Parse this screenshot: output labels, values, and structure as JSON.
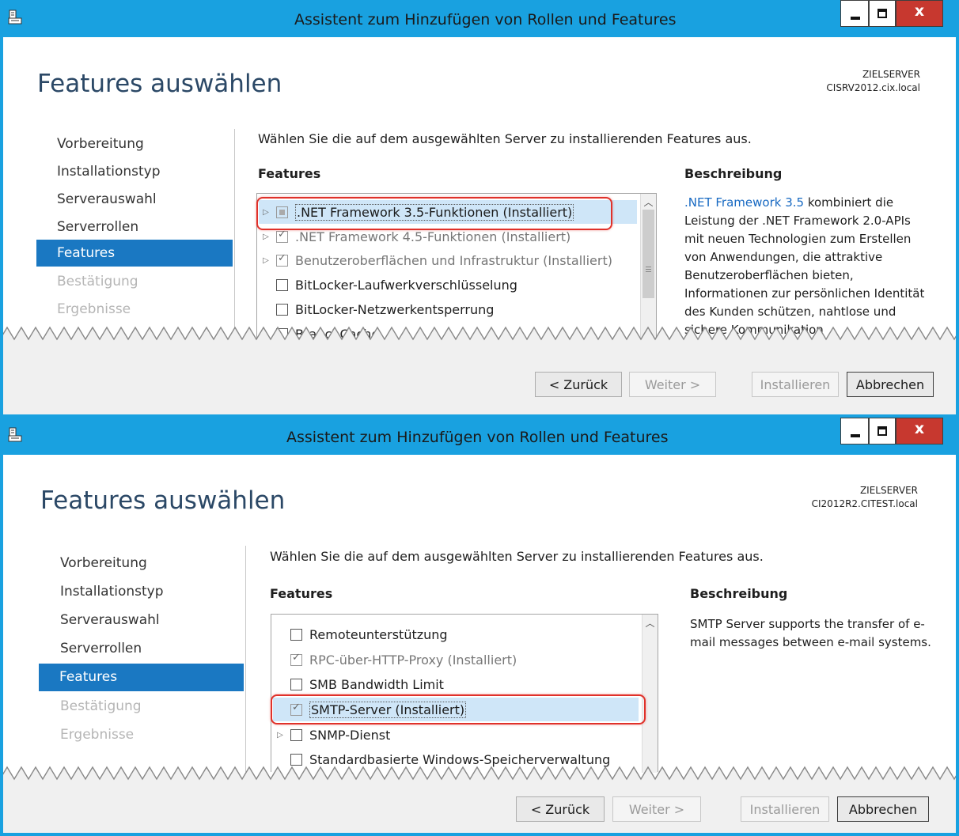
{
  "window1": {
    "title": "Assistent zum Hinzufügen von Rollen und Features",
    "page_title": "Features auswählen",
    "target_label": "ZIELSERVER",
    "target_server": "CISRV2012.cix.local",
    "nav": [
      "Vorbereitung",
      "Installationstyp",
      "Serverauswahl",
      "Serverrollen",
      "Features",
      "Bestätigung",
      "Ergebnisse"
    ],
    "nav_selected": "Features",
    "instruction": "Wählen Sie die auf dem ausgewählten Server zu installierenden Features aus.",
    "features_header": "Features",
    "description_header": "Beschreibung",
    "features": [
      {
        "label": ".NET Framework 3.5-Funktionen (Installiert)",
        "state": "partial",
        "expandable": true,
        "installed": true,
        "selected": true
      },
      {
        "label": ".NET Framework 4.5-Funktionen (Installiert)",
        "state": "checked",
        "expandable": true,
        "installed": true
      },
      {
        "label": "Benutzeroberflächen und Infrastruktur (Installiert)",
        "state": "checked",
        "expandable": true,
        "installed": true
      },
      {
        "label": "BitLocker-Laufwerkverschlüsselung",
        "state": "unchecked",
        "expandable": false
      },
      {
        "label": "BitLocker-Netzwerkentsperrung",
        "state": "unchecked",
        "expandable": false
      },
      {
        "label": "BranchCache",
        "state": "unchecked",
        "expandable": false
      }
    ],
    "description_link": ".NET Framework 3.5",
    "description": " kombiniert die Leistung der .NET Framework 2.0-APIs mit neuen Technologien zum Erstellen von Anwendungen, die attraktive Benutzeroberflächen bieten, Informationen zur persönlichen Identität des Kunden schützen, nahtlose und sichere Kommunikation",
    "buttons": {
      "back": "< Zurück",
      "next": "Weiter >",
      "install": "Installieren",
      "cancel": "Abbrechen"
    }
  },
  "window2": {
    "title": "Assistent zum Hinzufügen von Rollen und Features",
    "page_title": "Features auswählen",
    "target_label": "ZIELSERVER",
    "target_server": "CI2012R2.CITEST.local",
    "nav": [
      "Vorbereitung",
      "Installationstyp",
      "Serverauswahl",
      "Serverrollen",
      "Features",
      "Bestätigung",
      "Ergebnisse"
    ],
    "nav_selected": "Features",
    "instruction": "Wählen Sie die auf dem ausgewählten Server zu installierenden Features aus.",
    "features_header": "Features",
    "description_header": "Beschreibung",
    "features": [
      {
        "label": "Remoteunterstützung",
        "state": "unchecked",
        "expandable": false
      },
      {
        "label": "RPC-über-HTTP-Proxy (Installiert)",
        "state": "checked",
        "expandable": false,
        "installed": true
      },
      {
        "label": "SMB Bandwidth Limit",
        "state": "unchecked",
        "expandable": false
      },
      {
        "label": "SMTP-Server (Installiert)",
        "state": "checked",
        "expandable": false,
        "installed": true,
        "selected": true
      },
      {
        "label": "SNMP-Dienst",
        "state": "unchecked",
        "expandable": true
      },
      {
        "label": "Standardbasierte Windows-Speicherverwaltung",
        "state": "unchecked",
        "expandable": false
      }
    ],
    "description": "SMTP Server supports the transfer of e-mail messages between e-mail systems.",
    "buttons": {
      "back": "< Zurück",
      "next": "Weiter >",
      "install": "Installieren",
      "cancel": "Abbrechen"
    }
  },
  "colors": {
    "titlebar": "#19a1e0",
    "nav_selected": "#1a78c2",
    "title_text": "#2b4866",
    "highlight": "#e0312a",
    "close_button": "#c7382f"
  },
  "icons": {
    "app": "server-manager-icon",
    "minimize": "minimize-icon",
    "maximize": "maximize-icon",
    "close": "close-icon",
    "expand": "expand-arrow-icon",
    "scroll_up": "scroll-up-icon"
  }
}
